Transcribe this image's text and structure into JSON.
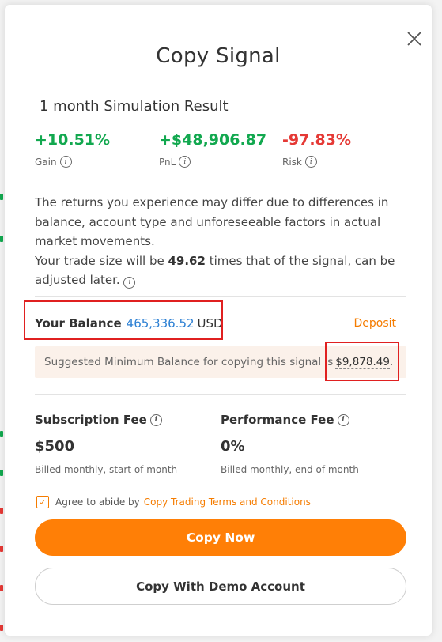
{
  "dialog": {
    "title": "Copy Signal",
    "subtitle": "1 month Simulation Result"
  },
  "metrics": [
    {
      "value": "+10.51%",
      "label": "Gain",
      "color": "#12a84f"
    },
    {
      "value": "+$48,906.87",
      "label": "PnL",
      "color": "#12a84f"
    },
    {
      "value": "-97.83%",
      "label": "Risk",
      "color": "#e53935"
    }
  ],
  "description": {
    "line1": "The returns you experience may differ due to differences in balance, account type and unforeseeable factors in actual market movements.",
    "line2_prefix": "Your trade size will be ",
    "multiplier": "49.62",
    "line2_suffix": " times that of the signal, can be adjusted later."
  },
  "balance": {
    "label": "Your Balance",
    "amount": "465,336.52",
    "currency": "USD",
    "deposit_label": "Deposit"
  },
  "suggestion": {
    "text": "Suggested Minimum Balance for copying this signal is",
    "amount": "$9,878.49",
    "suffix": "."
  },
  "fees": [
    {
      "title": "Subscription Fee",
      "value": "$500",
      "note": "Billed monthly, start of month"
    },
    {
      "title": "Performance Fee",
      "value": "0%",
      "note": "Billed monthly, end of month"
    }
  ],
  "agreement": {
    "checked": true,
    "text": "Agree to abide by",
    "link": "Copy Trading Terms and Conditions"
  },
  "buttons": {
    "primary": "Copy Now",
    "secondary": "Copy With Demo Account"
  },
  "icons": {
    "close": "close-icon",
    "info": "info-icon",
    "check": "check-icon"
  },
  "colors": {
    "accent": "#ff7f06",
    "positive": "#12a84f",
    "negative": "#e53935",
    "link": "#2b7fd3",
    "highlight_box": "#e02020"
  }
}
